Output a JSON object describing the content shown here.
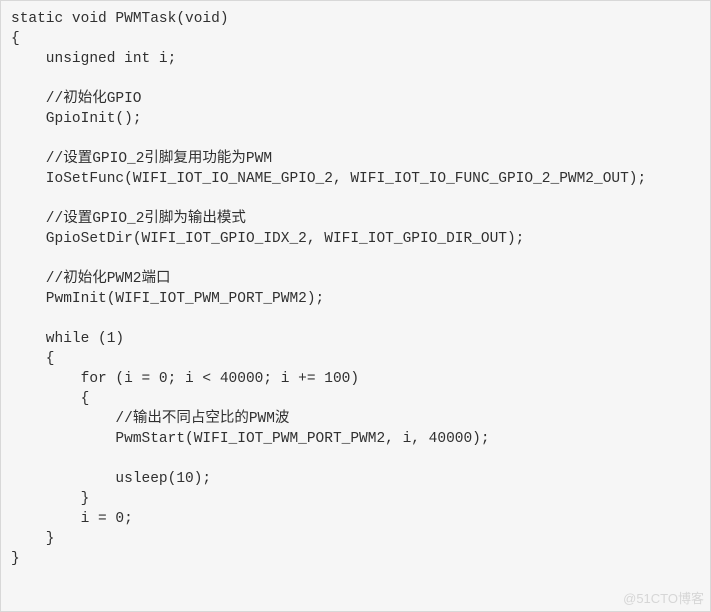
{
  "code": {
    "lines": [
      "static void PWMTask(void)",
      "{",
      "    unsigned int i;",
      "",
      "    //初始化GPIO",
      "    GpioInit();",
      "",
      "    //设置GPIO_2引脚复用功能为PWM",
      "    IoSetFunc(WIFI_IOT_IO_NAME_GPIO_2, WIFI_IOT_IO_FUNC_GPIO_2_PWM2_OUT);",
      "",
      "    //设置GPIO_2引脚为输出模式",
      "    GpioSetDir(WIFI_IOT_GPIO_IDX_2, WIFI_IOT_GPIO_DIR_OUT);",
      "",
      "    //初始化PWM2端口",
      "    PwmInit(WIFI_IOT_PWM_PORT_PWM2);",
      "",
      "    while (1)",
      "    {",
      "        for (i = 0; i < 40000; i += 100)",
      "        {",
      "            //输出不同占空比的PWM波",
      "            PwmStart(WIFI_IOT_PWM_PORT_PWM2, i, 40000);",
      "",
      "            usleep(10);",
      "        }",
      "        i = 0;",
      "    }",
      "}"
    ]
  },
  "watermark": "@51CTO博客"
}
